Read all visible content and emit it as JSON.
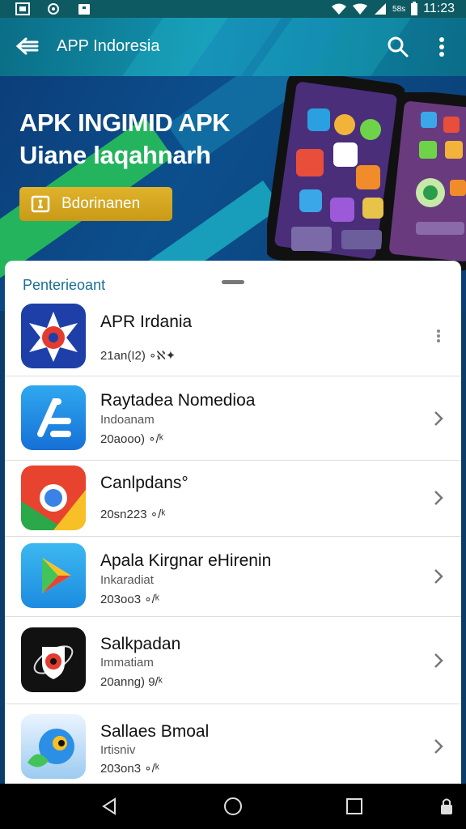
{
  "status_bar": {
    "small_label": "58s",
    "time": "11:23"
  },
  "app_bar": {
    "title": "APP Indoresia"
  },
  "banner": {
    "headline_line1": "APK INGIMID APK",
    "headline_line2": "Uiane laqahnarh",
    "cta_label": "Bdorinanen"
  },
  "sheet": {
    "title": "Penterieoant",
    "apps": [
      {
        "name": "APR Irdania",
        "subtitle": "",
        "meta": "21an(I2)  ∘ℵ✦",
        "icon": "star-shield-icon",
        "trailing": "dots"
      },
      {
        "name": "Raytadea Nomedioa",
        "subtitle": "Indoanam",
        "meta": "20aooo)  ∘/ᵏ",
        "icon": "app-store-icon",
        "trailing": "chevron"
      },
      {
        "name": "Canlpdans°",
        "subtitle": "",
        "meta": "20sn223  ∘/ᵏ",
        "icon": "chrome-icon",
        "trailing": "chevron"
      },
      {
        "name": "Apala Kirgnar eHirenin",
        "subtitle": "Inkaradiat",
        "meta": "203oo3  ∘/ᵏ",
        "icon": "play-store-icon",
        "trailing": "chevron"
      },
      {
        "name": "Salkpadan",
        "subtitle": "Immatiam",
        "meta": "20anng)  9/ᵏ",
        "icon": "shield-eye-icon",
        "trailing": "chevron"
      },
      {
        "name": "Sallaes Bmoal",
        "subtitle": "Irtisniv",
        "meta": "203on3  ∘/ᵏ",
        "icon": "bird-icon",
        "trailing": "chevron"
      }
    ]
  }
}
